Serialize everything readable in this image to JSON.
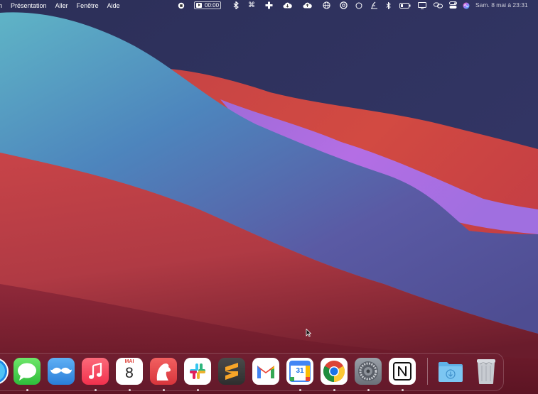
{
  "menubar": {
    "menus": [
      {
        "label": "n",
        "icon": ""
      },
      {
        "label": "Présentation"
      },
      {
        "label": "Aller"
      },
      {
        "label": "Fenêtre"
      },
      {
        "label": "Aide"
      }
    ],
    "status_icons": [
      "record-stop-icon",
      "screen-recorder-icon",
      "bluetooth-icon",
      "command-icon",
      "cross-app-icon",
      "cloud-icon",
      "cloud-upload-icon",
      "globe-icon",
      "lock-circle-icon",
      "circle-icon",
      "script-icon",
      "bluetooth-icon",
      "battery-icon",
      "display-icon",
      "link-icon",
      "toggle-icon",
      "siri-icon"
    ],
    "recorder_time": "00:00",
    "clock": "Sam. 8 mai à  23:31"
  },
  "dock": {
    "apps": [
      {
        "name": "Safari",
        "icon": "compass-icon"
      },
      {
        "name": "Messages",
        "icon": "speech-bubble-icon"
      },
      {
        "name": "Mail Mustache",
        "icon": "mustache-icon"
      },
      {
        "name": "Music",
        "icon": "music-note-icon"
      },
      {
        "name": "Calendar",
        "icon": "calendar-icon",
        "month": "MAI",
        "day": "8"
      },
      {
        "name": "Bear",
        "icon": "bear-icon"
      },
      {
        "name": "Slack",
        "icon": "slack-icon"
      },
      {
        "name": "Sublime Text",
        "icon": "sublime-icon"
      },
      {
        "name": "Gmail",
        "icon": "gmail-icon"
      },
      {
        "name": "Google Calendar",
        "icon": "google-calendar-icon",
        "day": "31"
      },
      {
        "name": "Chrome",
        "icon": "chrome-icon"
      },
      {
        "name": "System Preferences",
        "icon": "gear-icon"
      },
      {
        "name": "Notion",
        "icon": "notion-icon"
      },
      {
        "name": "Downloads",
        "icon": "downloads-folder-icon"
      },
      {
        "name": "Trash",
        "icon": "trash-icon"
      }
    ]
  },
  "colors": {
    "wallpaper_top": "#2c2f58",
    "wallpaper_teal": "#5aa3c4",
    "wallpaper_red": "#c84848",
    "wallpaper_purple": "#a469e0"
  }
}
